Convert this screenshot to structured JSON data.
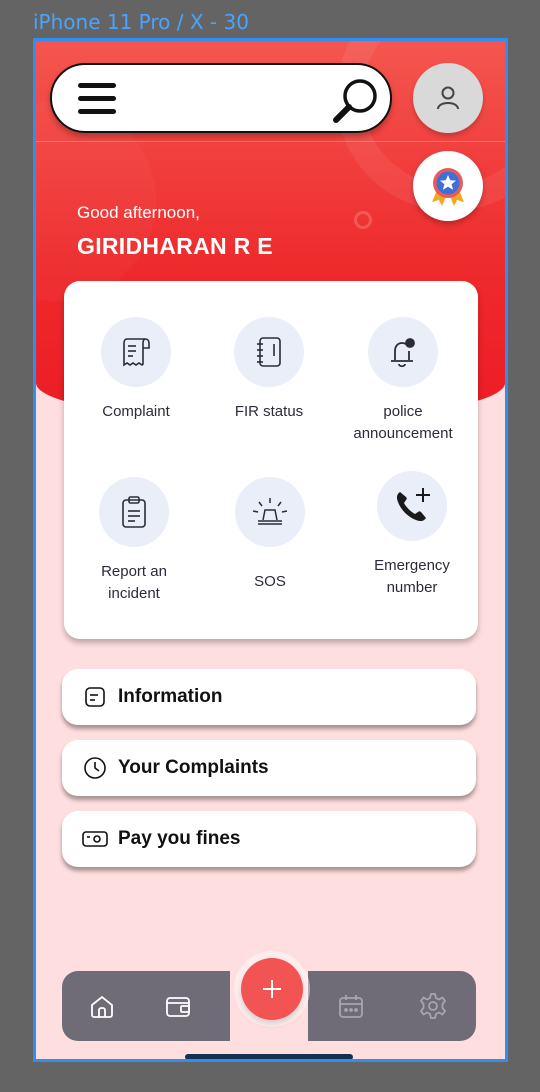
{
  "frame": {
    "title": "iPhone 11 Pro / X - 30"
  },
  "header": {
    "greeting": "Good afternoon,",
    "user_name": "GIRIDHARAN R E"
  },
  "services": [
    {
      "label": "Complaint",
      "icon": "receipt-icon"
    },
    {
      "label": "FIR status",
      "icon": "notebook-icon"
    },
    {
      "label": "police\nannouncement",
      "label_line1": "police",
      "label_line2": "announcement",
      "icon": "bell-icon"
    },
    {
      "label_line1": "Report an",
      "label_line2": "incident",
      "icon": "clipboard-icon"
    },
    {
      "label": "SOS",
      "icon": "siren-icon"
    },
    {
      "label_line1": "Emergency",
      "label_line2": "number",
      "icon": "phone-add-icon"
    }
  ],
  "actions": {
    "information": "Information",
    "complaints": "Your Complaints",
    "fines": "Pay you fines"
  },
  "bottom_nav": {
    "fab_icon": "plus-icon",
    "items": [
      "home-icon",
      "wallet-icon",
      "calendar-icon",
      "settings-icon"
    ]
  },
  "colors": {
    "accent_red": "#ec1c24",
    "background_pink": "#ffdedf",
    "nav_gray": "#6f6b77",
    "frame_blue": "#2f8ef0"
  }
}
